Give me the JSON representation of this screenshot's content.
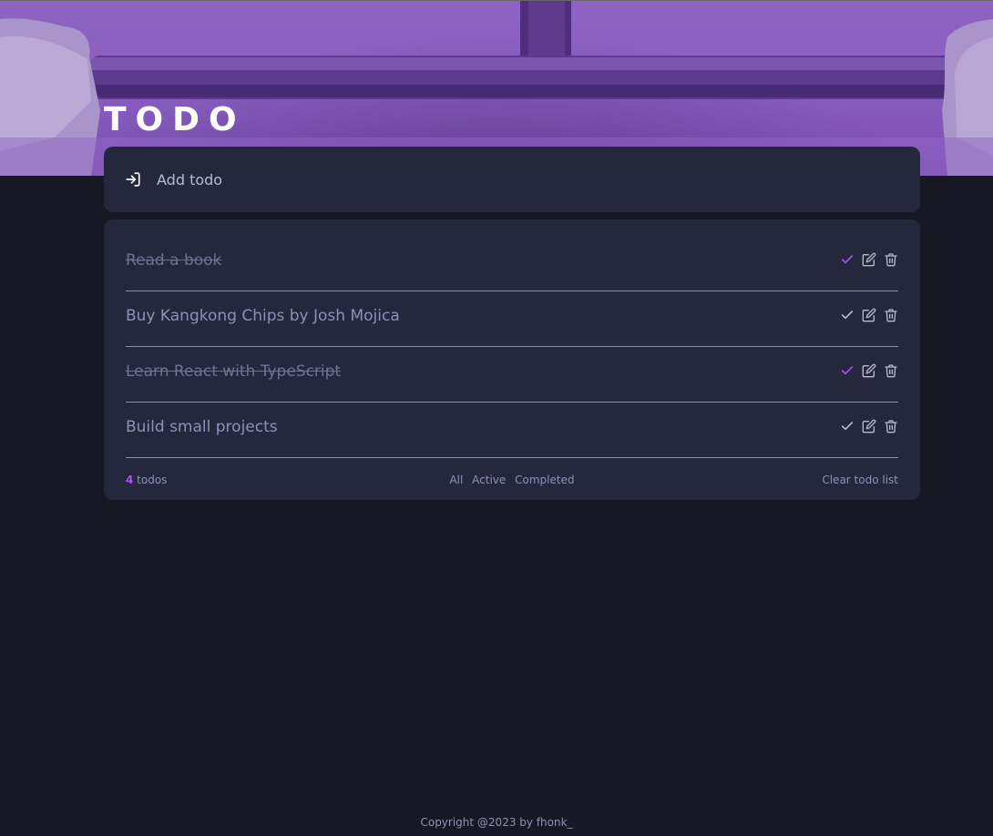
{
  "header": {
    "title": "TODO"
  },
  "add_todo": {
    "placeholder": "Add todo",
    "icon": "login-arrow-icon"
  },
  "todos": [
    {
      "text": "Read a book",
      "completed": true
    },
    {
      "text": "Buy Kangkong Chips by Josh Mojica",
      "completed": false
    },
    {
      "text": "Learn React with TypeScript",
      "completed": true
    },
    {
      "text": "Build small projects",
      "completed": false
    }
  ],
  "footer": {
    "count": "4",
    "count_suffix": " todos",
    "filters": [
      "All",
      "Active",
      "Completed"
    ],
    "clear_label": "Clear todo list"
  },
  "copyright": "Copyright @2023 by fhonk_",
  "colors": {
    "background": "#181824",
    "card": "#25273d",
    "accent": "#a855f7",
    "text_muted": "#8e91b5",
    "hero": "#8a5fc0"
  },
  "icons": [
    "check-icon",
    "edit-icon",
    "trash-icon"
  ]
}
